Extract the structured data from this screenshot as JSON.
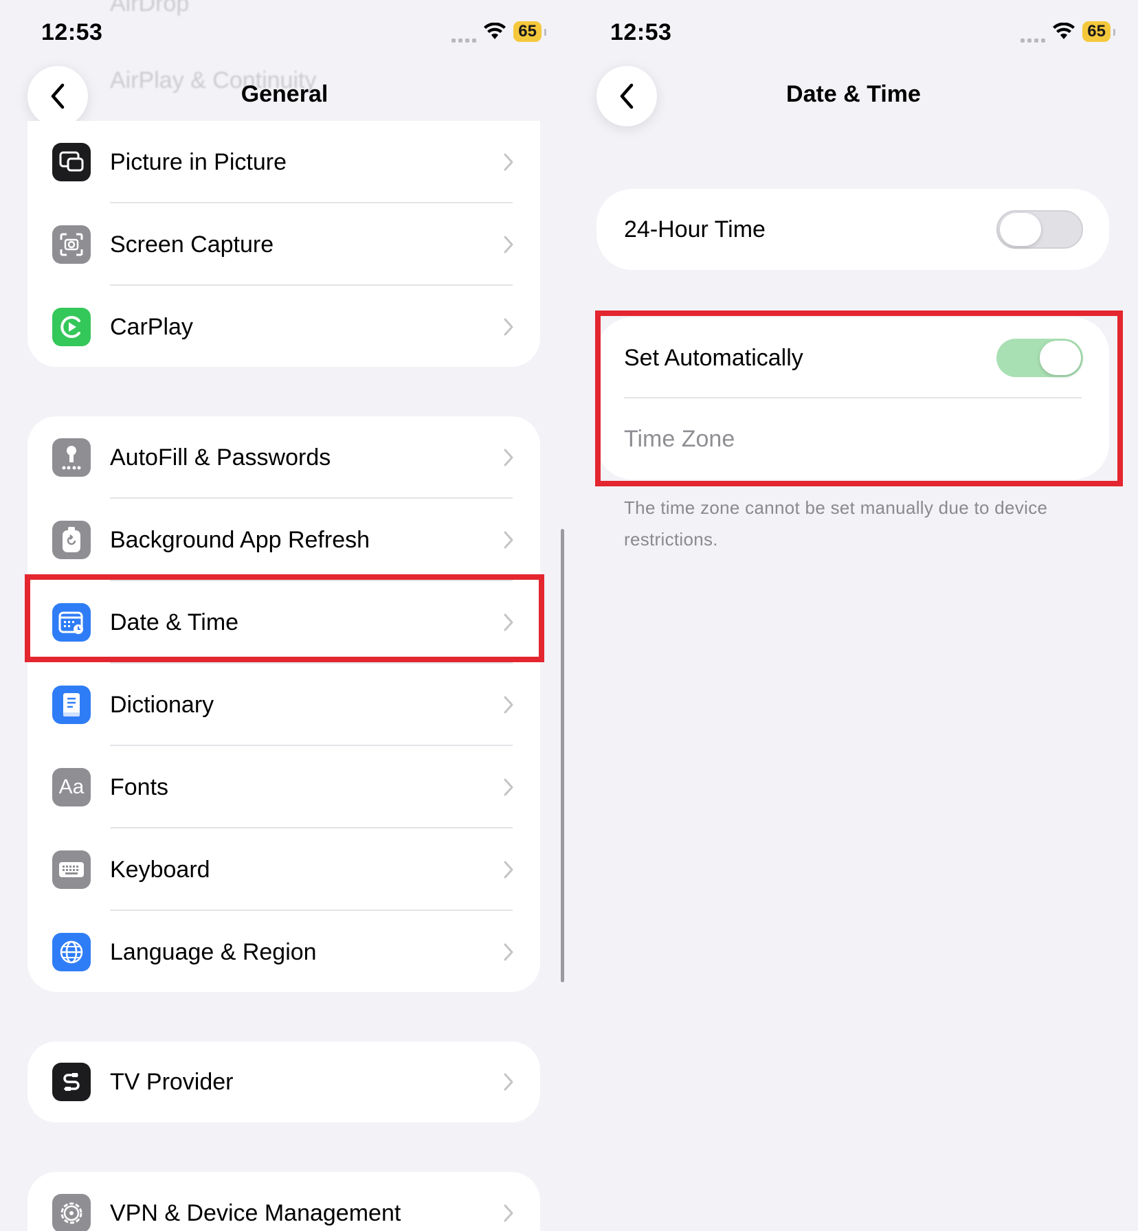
{
  "left": {
    "status": {
      "time": "12:53",
      "battery": "65"
    },
    "nav": {
      "title": "General"
    },
    "ghost_rows": [
      "AirDrop",
      "AirPlay & Continuity"
    ],
    "group1": [
      {
        "label": "Picture in Picture",
        "icon": "picture-in-picture-icon"
      },
      {
        "label": "Screen Capture",
        "icon": "screen-capture-icon"
      },
      {
        "label": "CarPlay",
        "icon": "carplay-icon"
      }
    ],
    "group2": [
      {
        "label": "AutoFill & Passwords",
        "icon": "autofill-key-icon"
      },
      {
        "label": "Background App Refresh",
        "icon": "background-refresh-icon"
      },
      {
        "label": "Date & Time",
        "icon": "date-time-icon"
      },
      {
        "label": "Dictionary",
        "icon": "dictionary-icon"
      },
      {
        "label": "Fonts",
        "icon": "fonts-icon",
        "glyph": "Aa"
      },
      {
        "label": "Keyboard",
        "icon": "keyboard-icon"
      },
      {
        "label": "Language & Region",
        "icon": "globe-icon"
      }
    ],
    "group3": [
      {
        "label": "TV Provider",
        "icon": "tv-provider-icon"
      }
    ],
    "group4": [
      {
        "label": "VPN & Device Management",
        "icon": "gear-icon"
      }
    ]
  },
  "right": {
    "status": {
      "time": "12:53",
      "battery": "65"
    },
    "nav": {
      "title": "Date & Time"
    },
    "hour24": {
      "label": "24-Hour Time",
      "on": false
    },
    "set_auto": {
      "label": "Set Automatically",
      "on": true
    },
    "time_zone": {
      "label": "Time Zone"
    },
    "footnote": "The time zone cannot be set manually due to device restrictions."
  },
  "colors": {
    "highlight": "#e3262f",
    "toggle_on": "#a9e0b3",
    "battery": "#f5c83c"
  }
}
